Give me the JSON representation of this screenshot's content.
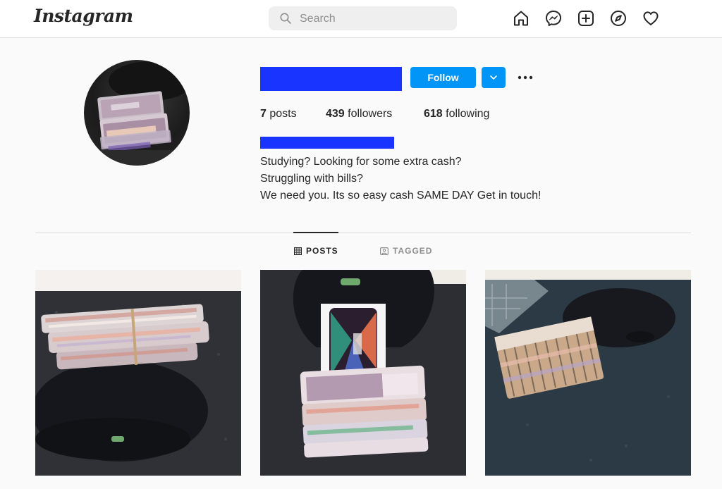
{
  "header": {
    "logo_text": "Instagram",
    "search_placeholder": "Search",
    "nav_icons": [
      "home-icon",
      "messenger-icon",
      "new-post-icon",
      "explore-icon",
      "activity-heart-icon"
    ]
  },
  "profile": {
    "follow_label": "Follow",
    "stats": {
      "posts_count": "7",
      "posts_label": "posts",
      "followers_count": "439",
      "followers_label": "followers",
      "following_count": "618",
      "following_label": "following"
    },
    "bio_lines": [
      "Studying? Looking for some extra cash?",
      "Struggling with bills?",
      "We need you. Its so easy cash SAME DAY Get in touch!"
    ]
  },
  "tabs": [
    {
      "label": "POSTS",
      "icon": "grid-icon",
      "active": true
    },
    {
      "label": "TAGGED",
      "icon": "tagged-icon",
      "active": false
    }
  ],
  "colors": {
    "accent": "#0095f6",
    "redaction": "#1a34ff"
  }
}
